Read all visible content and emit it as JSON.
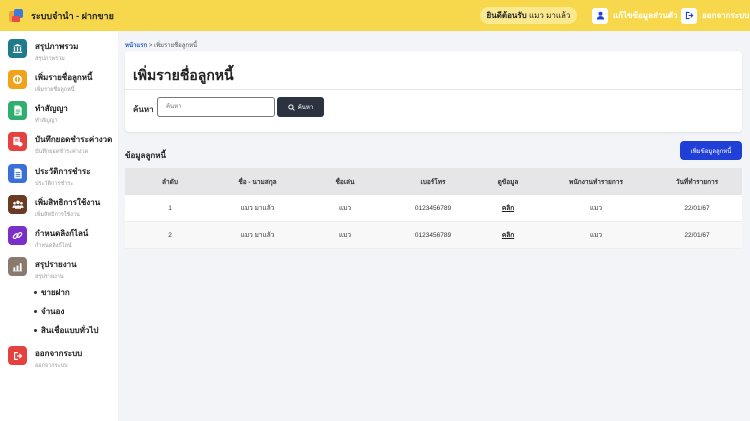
{
  "header": {
    "app_title": "ระบบจำนำ - ฝากขาย",
    "welcome_prefix": "ยินดีต้อนรับ",
    "welcome_user": "แมว มาแล้ว",
    "profile_label": "แก้ไขข้อมูลส่วนตัว",
    "logout_label": "ออกจากระบบ"
  },
  "sidebar": {
    "items": [
      {
        "title": "สรุปภาพรวม",
        "subtitle": "สรุปภาพรวม",
        "color": "#1f7a8c",
        "icon": "bank-icon"
      },
      {
        "title": "เพิ่มรายชื่อลูกหนี้",
        "subtitle": "เพิ่มรายชื่อลูกหนี้",
        "color": "#f0a21a",
        "icon": "coin-icon"
      },
      {
        "title": "ทำสัญญา",
        "subtitle": "ทำสัญญา",
        "color": "#2fae6e",
        "icon": "document-icon"
      },
      {
        "title": "บันทึกยอดชำระค่างวด",
        "subtitle": "บันทึกยอดชำระค่างวด",
        "color": "#e5413f",
        "icon": "payment-icon"
      },
      {
        "title": "ประวัติการชำระ",
        "subtitle": "ประวัติการชำระ",
        "color": "#3b6fd8",
        "icon": "history-icon"
      },
      {
        "title": "เพิ่มสิทธิการใช้งาน",
        "subtitle": "เพิ่มสิทธิการใช้งาน",
        "color": "#6b3a22",
        "icon": "users-icon"
      },
      {
        "title": "กำหนดลิงก์ไลน์",
        "subtitle": "กำหนดลิงก์ไลน์",
        "color": "#7b2fc9",
        "icon": "link-icon"
      },
      {
        "title": "สรุปรายงาน",
        "subtitle": "สรุปรายงาน",
        "color": "#8a7a6e",
        "icon": "chart-icon"
      }
    ],
    "sub_items": [
      "ขายฝาก",
      "จำนอง",
      "สินเชื่อแบบทั่วไป"
    ],
    "logout": {
      "title": "ออกจากระบบ",
      "subtitle": "ออกจากระบบ",
      "color": "#e5413f",
      "icon": "logout-icon"
    }
  },
  "breadcrumb": {
    "home": "หน้าแรก",
    "separator": ">",
    "current": "เพิ่มรายชื่อลูกหนี้"
  },
  "page": {
    "title": "เพิ่มรายชื่อลูกหนี้",
    "search_label": "ค้นหา",
    "search_placeholder": "ค้นหา",
    "search_button": "ค้นหา",
    "section_title": "ข้อมูลลูกหนี้",
    "add_button": "เพิ่มข้อมูลลูกหนี้"
  },
  "table": {
    "headers": [
      "ลำดับ",
      "ชื่อ - นามสกุล",
      "ชื่อเล่น",
      "เบอร์โทร",
      "ดูข้อมูล",
      "พนักงานทำรายการ",
      "วันที่ทำรายการ"
    ],
    "rows": [
      [
        "1",
        "แมว มาแล้ว",
        "แมว",
        "0123456789",
        "คลิก",
        "แมว",
        "22/01/67"
      ],
      [
        "2",
        "แมว มาแล้ว",
        "แมว",
        "0123456789",
        "คลิก",
        "แมว",
        "22/01/67"
      ]
    ]
  }
}
